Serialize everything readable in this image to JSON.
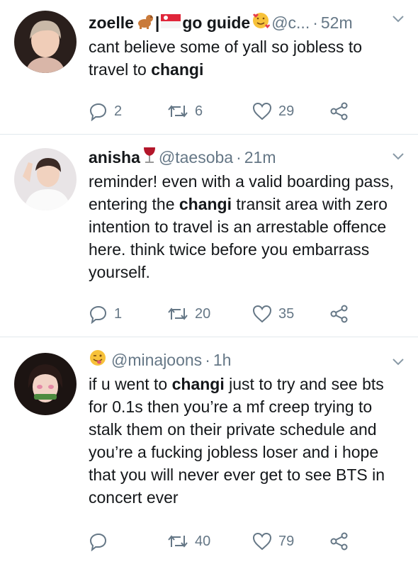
{
  "tweets": [
    {
      "name": "zoelle",
      "name_suffix": "go guide",
      "handle": "@c...",
      "time": "52m",
      "text_parts": [
        "cant believe some of yall so jobless to travel to ",
        "changi",
        ""
      ],
      "replies": "2",
      "retweets": "6",
      "likes": "29",
      "icons": [
        "dog-emoji-icon",
        "singapore-flag-icon",
        "smiling-hearts-emoji-icon"
      ]
    },
    {
      "name": "anisha",
      "handle": "@taesoba",
      "time": "21m",
      "text_parts": [
        "reminder! even with a valid boarding pass, entering the ",
        "changi",
        " transit area with zero intention to travel is an arrestable offence here. think twice before you embarrass yourself."
      ],
      "replies": "1",
      "retweets": "20",
      "likes": "35",
      "icons": [
        "wine-glass-emoji-icon"
      ]
    },
    {
      "name": "",
      "handle": "@minajoons",
      "time": "1h",
      "text_parts": [
        "if u went to ",
        "changi",
        " just to try and see bts for 0.1s then you’re a mf creep trying to stalk them on their private schedule and you’re a fucking jobless loser and i hope that you will never ever get to see BTS in concert ever"
      ],
      "replies": "",
      "retweets": "40",
      "likes": "79",
      "icons": [
        "winking-tongue-emoji-icon"
      ]
    }
  ],
  "colors": {
    "text": "#14171a",
    "meta": "#657786",
    "divider": "#e1e8ed"
  }
}
